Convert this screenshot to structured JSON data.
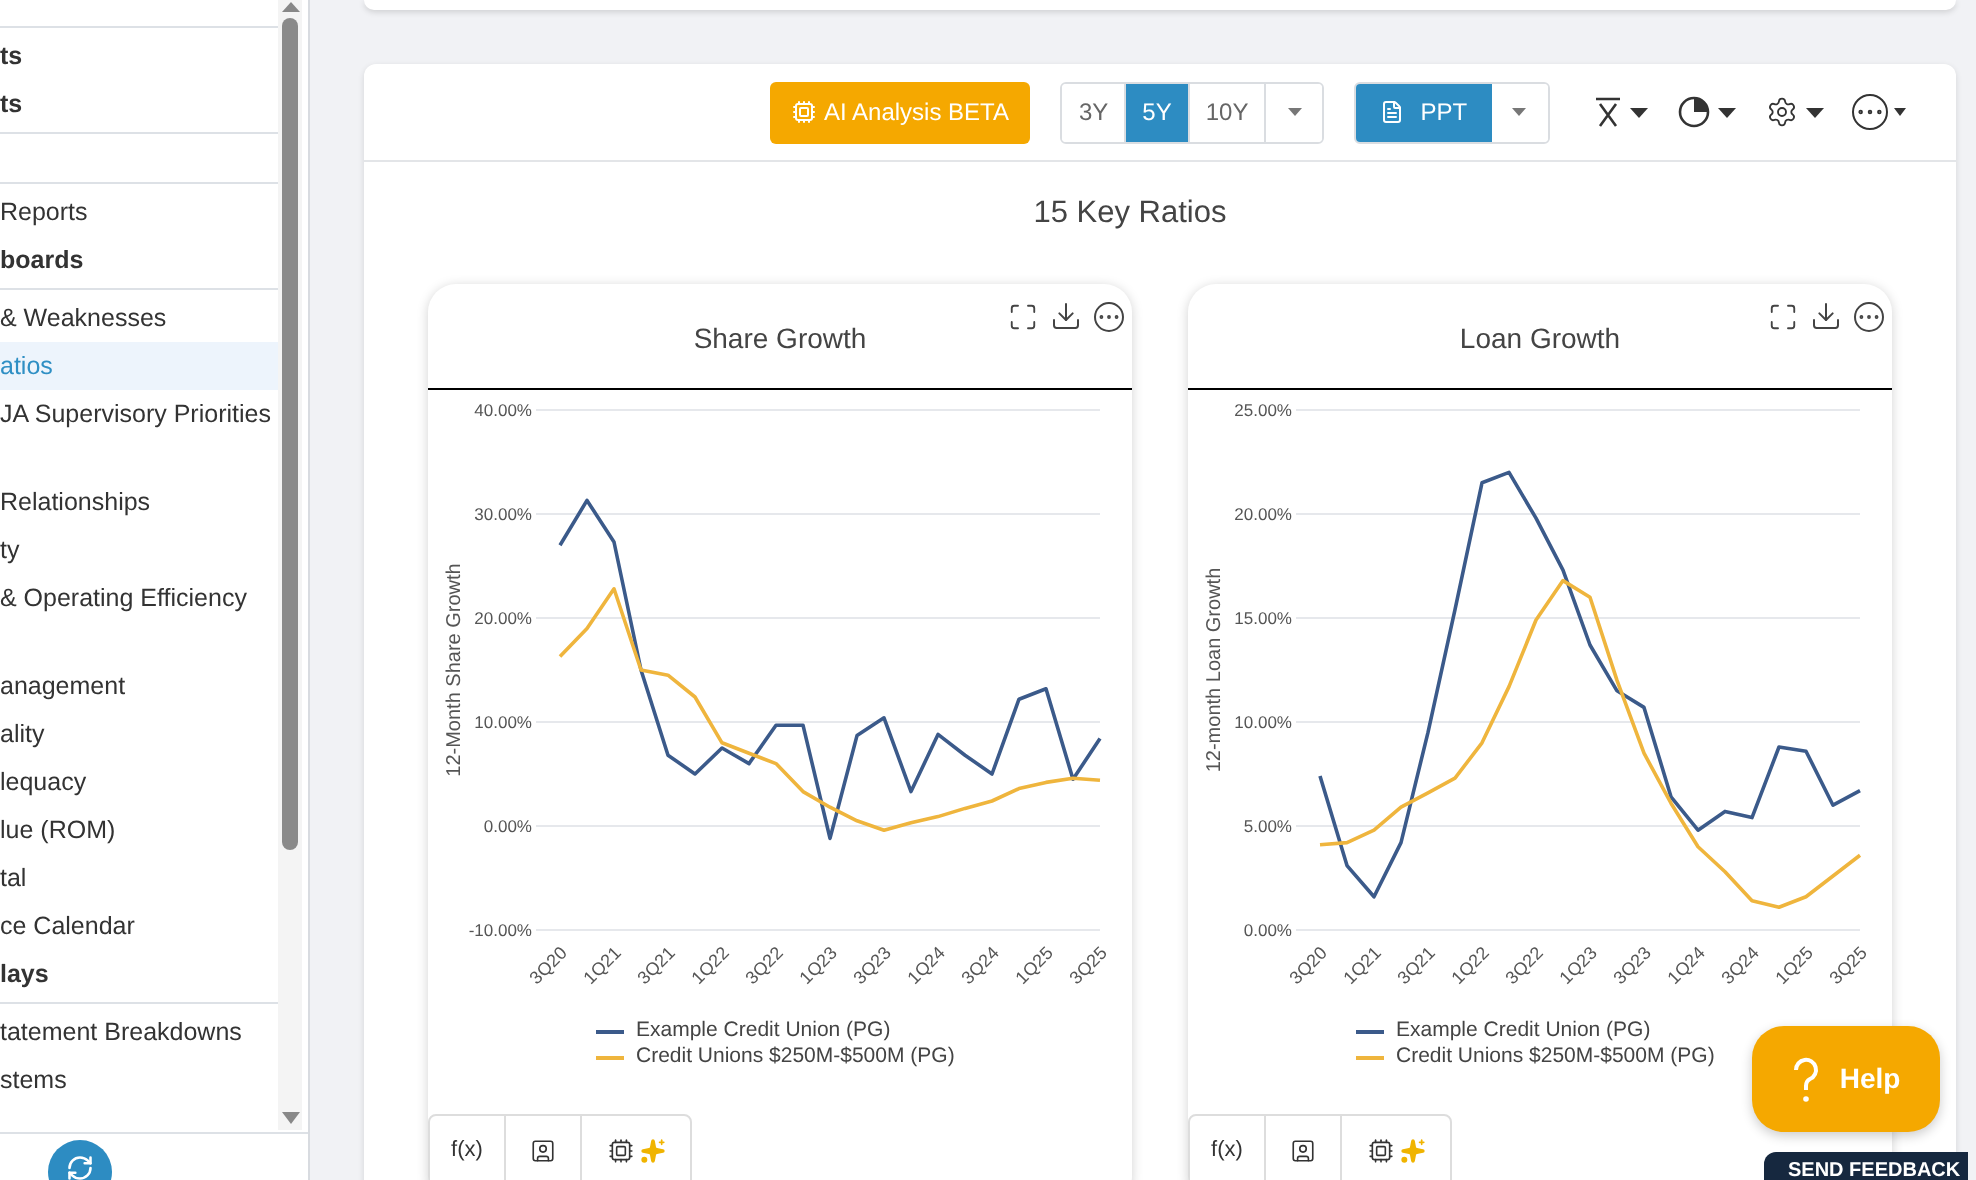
{
  "sidebar": {
    "items": [
      {
        "kind": "divider"
      },
      {
        "kind": "heading",
        "label": "ts",
        "selected": false
      },
      {
        "kind": "heading",
        "label": "ts",
        "selected": false
      },
      {
        "kind": "divider"
      },
      {
        "kind": "spacer"
      },
      {
        "kind": "divider"
      },
      {
        "kind": "item",
        "label": "Reports",
        "selected": false
      },
      {
        "kind": "heading",
        "label": "boards",
        "selected": false
      },
      {
        "kind": "divider"
      },
      {
        "kind": "item",
        "label": "& Weaknesses",
        "selected": false
      },
      {
        "kind": "item",
        "label": "atios",
        "selected": true
      },
      {
        "kind": "item",
        "label": "JA Supervisory Priorities",
        "selected": false
      },
      {
        "kind": "spacer"
      },
      {
        "kind": "item",
        "label": "Relationships",
        "selected": false
      },
      {
        "kind": "item",
        "label": "ty",
        "selected": false
      },
      {
        "kind": "item",
        "label": "& Operating Efficiency",
        "selected": false
      },
      {
        "kind": "spacer"
      },
      {
        "kind": "item",
        "label": "anagement",
        "selected": false
      },
      {
        "kind": "item",
        "label": "ality",
        "selected": false
      },
      {
        "kind": "item",
        "label": "lequacy",
        "selected": false
      },
      {
        "kind": "item",
        "label": "lue (ROM)",
        "selected": false
      },
      {
        "kind": "item",
        "label": "tal",
        "selected": false
      },
      {
        "kind": "item",
        "label": "ce Calendar",
        "selected": false
      },
      {
        "kind": "heading",
        "label": "lays",
        "selected": false
      },
      {
        "kind": "divider"
      },
      {
        "kind": "item",
        "label": "tatement Breakdowns",
        "selected": false
      },
      {
        "kind": "item",
        "label": "stems",
        "selected": false
      }
    ]
  },
  "toolbar": {
    "ai_button": "AI Analysis BETA",
    "periods": [
      {
        "label": "3Y",
        "selected": false
      },
      {
        "label": "5Y",
        "selected": true
      },
      {
        "label": "10Y",
        "selected": false
      }
    ],
    "export_button": "PPT"
  },
  "section_title": "15 Key Ratios",
  "charts": [
    {
      "title": "Share Growth",
      "tabs": [
        "f(x)"
      ],
      "chart_data": {
        "type": "line",
        "grid": true,
        "ylabel": "12-Month Share Growth",
        "categories": [
          "3Q20",
          null,
          "1Q21",
          null,
          "3Q21",
          null,
          "1Q22",
          null,
          "3Q22",
          null,
          "1Q23",
          null,
          "3Q23",
          null,
          "1Q24",
          null,
          "3Q24",
          null,
          "1Q25",
          null,
          "3Q25"
        ],
        "ylim": [
          -10,
          40
        ],
        "yticks": [
          {
            "value": 40,
            "label": "40.00%"
          },
          {
            "value": 30,
            "label": "30.00%"
          },
          {
            "value": 20,
            "label": "20.00%"
          },
          {
            "value": 10,
            "label": "10.00%"
          },
          {
            "value": 0,
            "label": "0.00%"
          },
          {
            "value": -10,
            "label": "-10.00%"
          }
        ],
        "series": [
          {
            "name": "Example Credit Union (PG)",
            "color": "#3b5a8a",
            "values": [
              27,
              31.3,
              27.3,
              15,
              6.8,
              5,
              7.5,
              6,
              9.7,
              9.7,
              -1.2,
              8.7,
              10.4,
              3.3,
              8.8,
              6.8,
              5,
              12.2,
              13.2,
              4.5,
              8.4
            ]
          },
          {
            "name": "Credit Unions $250M-$500M (PG)",
            "color": "#efb53d",
            "values": [
              16.3,
              19,
              22.8,
              15,
              14.5,
              12.4,
              8,
              7,
              6,
              3.3,
              1.8,
              0.5,
              -0.4,
              0.3,
              0.9,
              1.7,
              2.4,
              3.6,
              4.2,
              4.6,
              4.4
            ]
          }
        ]
      }
    },
    {
      "title": "Loan Growth",
      "tabs": [
        "f(x)"
      ],
      "chart_data": {
        "type": "line",
        "grid": true,
        "ylabel": "12-month Loan Growth",
        "categories": [
          "3Q20",
          null,
          "1Q21",
          null,
          "3Q21",
          null,
          "1Q22",
          null,
          "3Q22",
          null,
          "1Q23",
          null,
          "3Q23",
          null,
          "1Q24",
          null,
          "3Q24",
          null,
          "1Q25",
          null,
          "3Q25"
        ],
        "ylim": [
          0,
          25
        ],
        "yticks": [
          {
            "value": 25,
            "label": "25.00%"
          },
          {
            "value": 20,
            "label": "20.00%"
          },
          {
            "value": 15,
            "label": "15.00%"
          },
          {
            "value": 10,
            "label": "10.00%"
          },
          {
            "value": 5,
            "label": "5.00%"
          },
          {
            "value": 0,
            "label": "0.00%"
          }
        ],
        "series": [
          {
            "name": "Example Credit Union (PG)",
            "color": "#3b5a8a",
            "values": [
              7.4,
              3.1,
              1.6,
              4.2,
              9.5,
              15.4,
              21.5,
              22,
              19.8,
              17.3,
              13.7,
              11.5,
              10.7,
              6.4,
              4.8,
              5.7,
              5.4,
              8.8,
              8.6,
              6,
              6.7
            ]
          },
          {
            "name": "Credit Unions $250M-$500M (PG)",
            "color": "#efb53d",
            "values": [
              4.1,
              4.2,
              4.8,
              5.9,
              6.6,
              7.3,
              9,
              11.7,
              14.9,
              16.8,
              16,
              12,
              8.5,
              6.1,
              4,
              2.8,
              1.4,
              1.1,
              1.6,
              2.6,
              3.6
            ]
          }
        ]
      }
    }
  ],
  "help_button": "Help",
  "feedback_tab": "SEND FEEDBACK"
}
